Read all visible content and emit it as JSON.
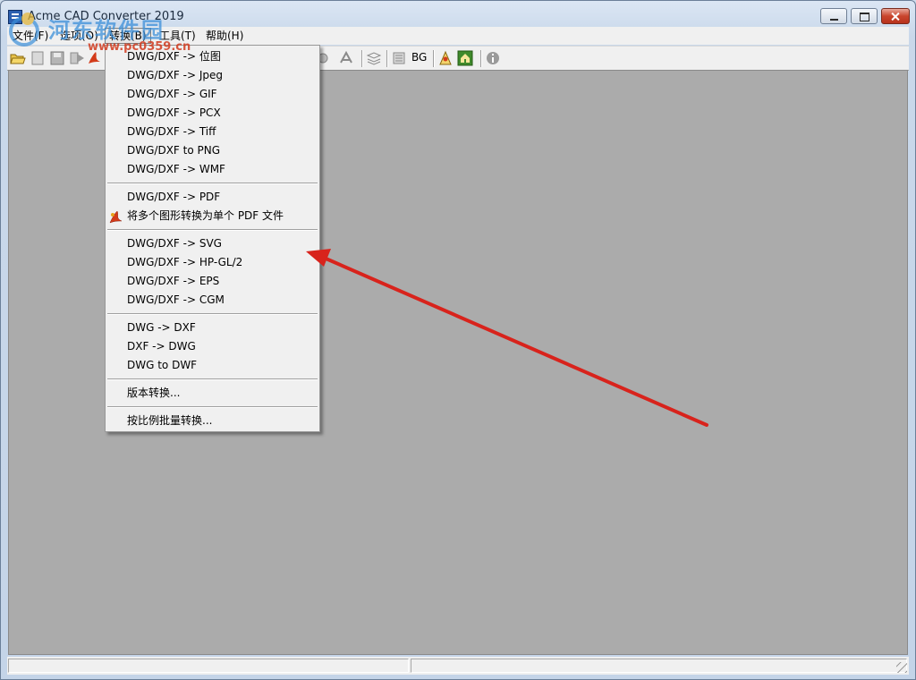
{
  "window": {
    "title": "Acme CAD Converter 2019"
  },
  "menubar": {
    "items": [
      "文件(F)",
      "选项(O)",
      "转换(B)",
      "工具(T)",
      "帮助(H)"
    ]
  },
  "toolbar": {
    "bg_label": "BG"
  },
  "convert_menu": {
    "group1": [
      "DWG/DXF -> 位图",
      "DWG/DXF -> Jpeg",
      "DWG/DXF -> GIF",
      "DWG/DXF -> PCX",
      "DWG/DXF -> Tiff",
      "DWG/DXF to PNG",
      "DWG/DXF -> WMF"
    ],
    "group2": [
      "DWG/DXF -> PDF",
      "将多个图形转换为单个 PDF 文件"
    ],
    "group3": [
      "DWG/DXF -> SVG",
      "DWG/DXF -> HP-GL/2",
      "DWG/DXF -> EPS",
      "DWG/DXF -> CGM"
    ],
    "group4": [
      "DWG -> DXF",
      "DXF -> DWG",
      "DWG to DWF"
    ],
    "group5": [
      "版本转换..."
    ],
    "group6": [
      "按比例批量转换..."
    ]
  },
  "watermark": {
    "site_name": "河东软件园",
    "url": "www.pc0359.cn"
  },
  "colors": {
    "arrow": "#d8231c",
    "workspace": "#ababab"
  }
}
